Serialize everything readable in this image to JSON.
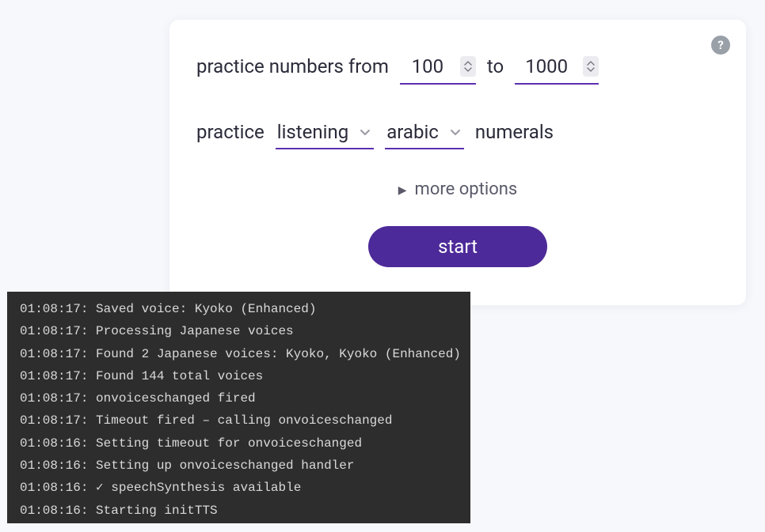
{
  "card": {
    "range": {
      "label_prefix": "practice numbers from",
      "from_value": "100",
      "label_to": "to",
      "to_value": "1000"
    },
    "mode": {
      "label_prefix": "practice",
      "practice_type": "listening",
      "numeral_system": "arabic",
      "label_suffix": "numerals"
    },
    "more_options_label": "more options",
    "start_label": "start",
    "help_icon": "?"
  },
  "console": {
    "lines": [
      {
        "time": "01:08:17",
        "msg": "Saved voice: Kyoko (Enhanced)"
      },
      {
        "time": "01:08:17",
        "msg": "Processing Japanese voices"
      },
      {
        "time": "01:08:17",
        "msg": "Found 2 Japanese voices: Kyoko, Kyoko (Enhanced)"
      },
      {
        "time": "01:08:17",
        "msg": "Found 144 total voices"
      },
      {
        "time": "01:08:17",
        "msg": "onvoiceschanged fired"
      },
      {
        "time": "01:08:17",
        "msg": "Timeout fired – calling onvoiceschanged"
      },
      {
        "time": "01:08:16",
        "msg": "Setting timeout for onvoiceschanged"
      },
      {
        "time": "01:08:16",
        "msg": "Setting up onvoiceschanged handler"
      },
      {
        "time": "01:08:16",
        "msg": "✓ speechSynthesis available"
      },
      {
        "time": "01:08:16",
        "msg": "Starting initTTS"
      }
    ]
  },
  "colors": {
    "accent": "#5b2fb0",
    "button": "#4d2a99",
    "console_bg": "#2d2d2d",
    "card_bg": "#ffffff",
    "page_bg": "#f7f8fc"
  }
}
